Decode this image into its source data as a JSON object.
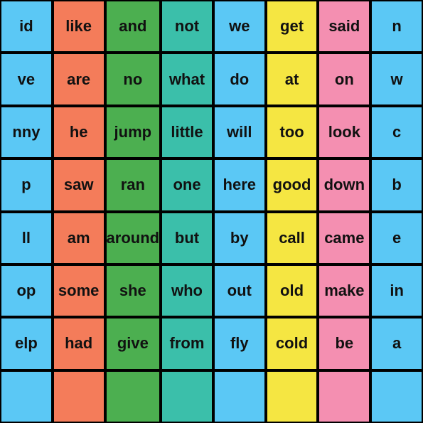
{
  "grid": {
    "cols": 8,
    "rows": 8,
    "cells": [
      {
        "word": "id",
        "color": "blue"
      },
      {
        "word": "like",
        "color": "salmon"
      },
      {
        "word": "and",
        "color": "green"
      },
      {
        "word": "not",
        "color": "teal"
      },
      {
        "word": "we",
        "color": "blue"
      },
      {
        "word": "get",
        "color": "yellow"
      },
      {
        "word": "said",
        "color": "pink"
      },
      {
        "word": "n",
        "color": "blue"
      },
      {
        "word": "ve",
        "color": "blue"
      },
      {
        "word": "are",
        "color": "salmon"
      },
      {
        "word": "no",
        "color": "green"
      },
      {
        "word": "what",
        "color": "teal"
      },
      {
        "word": "do",
        "color": "blue"
      },
      {
        "word": "at",
        "color": "yellow"
      },
      {
        "word": "on",
        "color": "pink"
      },
      {
        "word": "w",
        "color": "blue"
      },
      {
        "word": "nny",
        "color": "blue"
      },
      {
        "word": "he",
        "color": "salmon"
      },
      {
        "word": "jump",
        "color": "green"
      },
      {
        "word": "little",
        "color": "teal"
      },
      {
        "word": "will",
        "color": "blue"
      },
      {
        "word": "too",
        "color": "yellow"
      },
      {
        "word": "look",
        "color": "pink"
      },
      {
        "word": "c",
        "color": "blue"
      },
      {
        "word": "p",
        "color": "blue"
      },
      {
        "word": "saw",
        "color": "salmon"
      },
      {
        "word": "ran",
        "color": "green"
      },
      {
        "word": "one",
        "color": "teal"
      },
      {
        "word": "here",
        "color": "blue"
      },
      {
        "word": "good",
        "color": "yellow"
      },
      {
        "word": "down",
        "color": "pink"
      },
      {
        "word": "b",
        "color": "blue"
      },
      {
        "word": "ll",
        "color": "blue"
      },
      {
        "word": "am",
        "color": "salmon"
      },
      {
        "word": "around",
        "color": "green"
      },
      {
        "word": "but",
        "color": "teal"
      },
      {
        "word": "by",
        "color": "blue"
      },
      {
        "word": "call",
        "color": "yellow"
      },
      {
        "word": "came",
        "color": "pink"
      },
      {
        "word": "e",
        "color": "blue"
      },
      {
        "word": "op",
        "color": "blue"
      },
      {
        "word": "some",
        "color": "salmon"
      },
      {
        "word": "she",
        "color": "green"
      },
      {
        "word": "who",
        "color": "teal"
      },
      {
        "word": "out",
        "color": "blue"
      },
      {
        "word": "old",
        "color": "yellow"
      },
      {
        "word": "make",
        "color": "pink"
      },
      {
        "word": "in",
        "color": "blue"
      },
      {
        "word": "elp",
        "color": "blue"
      },
      {
        "word": "had",
        "color": "salmon"
      },
      {
        "word": "give",
        "color": "green"
      },
      {
        "word": "from",
        "color": "teal"
      },
      {
        "word": "fly",
        "color": "blue"
      },
      {
        "word": "cold",
        "color": "yellow"
      },
      {
        "word": "be",
        "color": "pink"
      },
      {
        "word": "a",
        "color": "blue"
      },
      {
        "word": "",
        "color": "blue"
      },
      {
        "word": "",
        "color": "salmon"
      },
      {
        "word": "",
        "color": "green"
      },
      {
        "word": "",
        "color": "teal"
      },
      {
        "word": "",
        "color": "blue"
      },
      {
        "word": "",
        "color": "yellow"
      },
      {
        "word": "",
        "color": "pink"
      },
      {
        "word": "",
        "color": "blue"
      }
    ]
  }
}
